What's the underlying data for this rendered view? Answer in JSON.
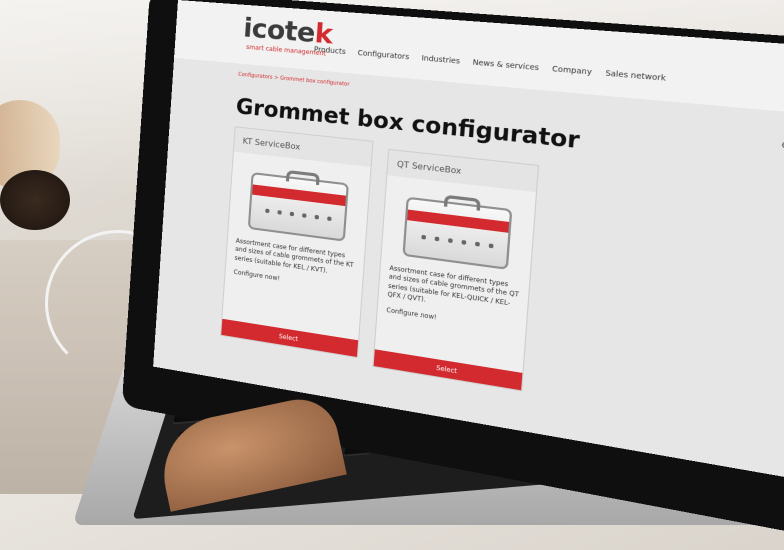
{
  "brand": {
    "logo_prefix": "icote",
    "logo_suffix": "k",
    "tagline": "smart cable management"
  },
  "nav": {
    "items": [
      "Products",
      "Configurators",
      "Industries",
      "News & services",
      "Company",
      "Sales network"
    ]
  },
  "breadcrumb": "Configurators > Grommet box configurator",
  "page": {
    "title": "Grommet box configurator"
  },
  "cards": [
    {
      "title": "KT ServiceBox",
      "description": "Assortment case for different types and sizes of cable grommets of the KT series (suitable for KEL / KVT).",
      "link": "Configure now!",
      "button": "Select"
    },
    {
      "title": "QT ServiceBox",
      "description": "Assortment case for different types and sizes of cable grommets of the QT series (suitable for KEL-QUICK / KEL-QFX / QVT).",
      "link": "Configure now!",
      "button": "Select"
    }
  ],
  "icons": {
    "globe": "globe-icon",
    "phone": "phone-icon",
    "search": "search-icon",
    "cart": "cart-icon"
  },
  "colors": {
    "brand_red": "#d22a2e",
    "text_dark": "#111111"
  }
}
